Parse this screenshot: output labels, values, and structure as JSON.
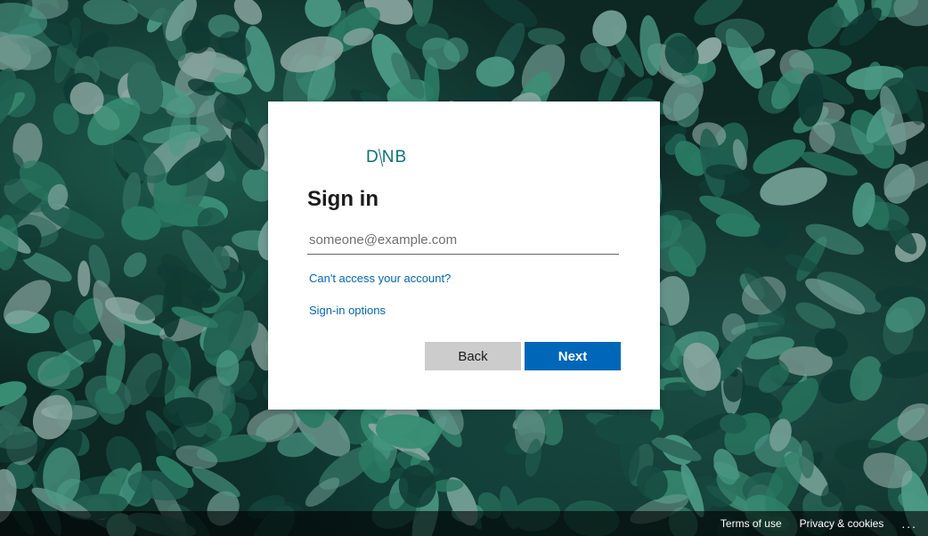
{
  "brand": {
    "logo_left": "D",
    "logo_right": "NB",
    "logo_color": "#0b7373"
  },
  "signin": {
    "title": "Sign in",
    "email_value": "",
    "email_placeholder": "someone@example.com",
    "cant_access_link": "Can't access your account?",
    "signin_options_link": "Sign-in options",
    "back_label": "Back",
    "next_label": "Next",
    "accent_color": "#0067b8"
  },
  "footer": {
    "terms_label": "Terms of use",
    "privacy_label": "Privacy & cookies",
    "more_label": "..."
  }
}
